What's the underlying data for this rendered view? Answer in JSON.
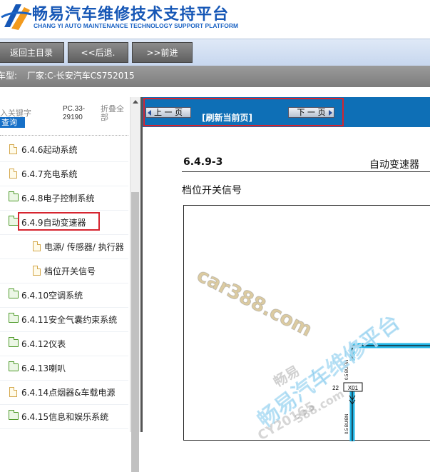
{
  "header": {
    "title_cn": "畅易汽车维修技术支持平台",
    "title_en": "CHANG YI AUTO MAINTENANCE TECHNOLOGY SUPPORT PLATFORM"
  },
  "nav": {
    "home": "返回主目录",
    "back": "<<后退.",
    "forward": ">>前进"
  },
  "model_bar": {
    "label": "车型:",
    "maker": "厂家:C-长安汽车CS752015"
  },
  "sidebar": {
    "keyword_placeholder": "入关键字",
    "query_button": "查询",
    "pc_code": "PC.33-29190",
    "collapse_all": "折叠全部",
    "items": [
      {
        "label": "6.4.6起动系统",
        "icon": "file-icon"
      },
      {
        "label": "6.4.7充电系统",
        "icon": "file-icon"
      },
      {
        "label": "6.4.8电子控制系统",
        "icon": "folder-icon"
      },
      {
        "label": "6.4.9自动变速器",
        "icon": "folder-icon"
      },
      {
        "label": "电源/ 传感器/ 执行器",
        "icon": "file-icon"
      },
      {
        "label": "档位开关信号",
        "icon": "file-icon"
      },
      {
        "label": "6.4.10空调系统",
        "icon": "folder-icon"
      },
      {
        "label": "6.4.11安全气囊约束系统",
        "icon": "folder-icon"
      },
      {
        "label": "6.4.12仪表",
        "icon": "folder-icon"
      },
      {
        "label": "6.4.13喇叭",
        "icon": "folder-icon"
      },
      {
        "label": "6.4.14点烟器&车载电源",
        "icon": "file-icon"
      },
      {
        "label": "6.4.15信息和娱乐系统",
        "icon": "folder-icon"
      }
    ]
  },
  "toolbar": {
    "prev_page": "上 一 页",
    "next_page": "下 一 页",
    "refresh": "[刷新当前页]"
  },
  "document": {
    "section_number": "6.4.9-3",
    "section_name": "自动变速器",
    "subtitle": "档位开关信号",
    "pin_number": "22",
    "connector": "X01",
    "wire_label": "0.5 BU/BN"
  },
  "watermarks": {
    "site": "car388.com",
    "brand": "畅易汽车维修平台",
    "faint_1": "畅易",
    "faint_2": "388.com",
    "faint_3": "CY20165"
  },
  "colors": {
    "brand_blue": "#1657b6",
    "toolbar_blue": "#0e6fb6",
    "highlight_red": "#d6242f",
    "wire_cyan": "#22b5e6"
  }
}
